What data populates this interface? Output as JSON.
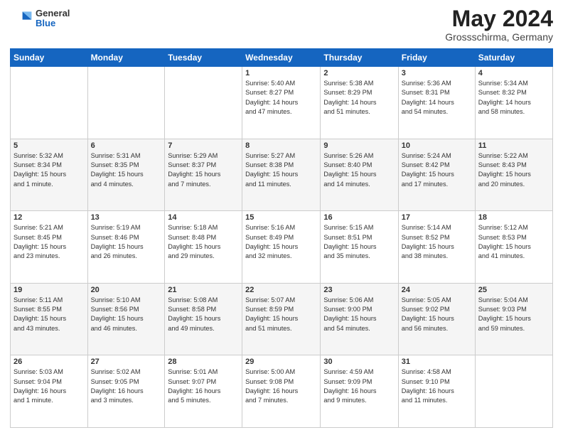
{
  "header": {
    "logo": {
      "general": "General",
      "blue": "Blue"
    },
    "title": "May 2024",
    "location": "Grossschirma, Germany"
  },
  "weekdays": [
    "Sunday",
    "Monday",
    "Tuesday",
    "Wednesday",
    "Thursday",
    "Friday",
    "Saturday"
  ],
  "weeks": [
    [
      {
        "day": "",
        "info": ""
      },
      {
        "day": "",
        "info": ""
      },
      {
        "day": "",
        "info": ""
      },
      {
        "day": "1",
        "info": "Sunrise: 5:40 AM\nSunset: 8:27 PM\nDaylight: 14 hours\nand 47 minutes."
      },
      {
        "day": "2",
        "info": "Sunrise: 5:38 AM\nSunset: 8:29 PM\nDaylight: 14 hours\nand 51 minutes."
      },
      {
        "day": "3",
        "info": "Sunrise: 5:36 AM\nSunset: 8:31 PM\nDaylight: 14 hours\nand 54 minutes."
      },
      {
        "day": "4",
        "info": "Sunrise: 5:34 AM\nSunset: 8:32 PM\nDaylight: 14 hours\nand 58 minutes."
      }
    ],
    [
      {
        "day": "5",
        "info": "Sunrise: 5:32 AM\nSunset: 8:34 PM\nDaylight: 15 hours\nand 1 minute."
      },
      {
        "day": "6",
        "info": "Sunrise: 5:31 AM\nSunset: 8:35 PM\nDaylight: 15 hours\nand 4 minutes."
      },
      {
        "day": "7",
        "info": "Sunrise: 5:29 AM\nSunset: 8:37 PM\nDaylight: 15 hours\nand 7 minutes."
      },
      {
        "day": "8",
        "info": "Sunrise: 5:27 AM\nSunset: 8:38 PM\nDaylight: 15 hours\nand 11 minutes."
      },
      {
        "day": "9",
        "info": "Sunrise: 5:26 AM\nSunset: 8:40 PM\nDaylight: 15 hours\nand 14 minutes."
      },
      {
        "day": "10",
        "info": "Sunrise: 5:24 AM\nSunset: 8:42 PM\nDaylight: 15 hours\nand 17 minutes."
      },
      {
        "day": "11",
        "info": "Sunrise: 5:22 AM\nSunset: 8:43 PM\nDaylight: 15 hours\nand 20 minutes."
      }
    ],
    [
      {
        "day": "12",
        "info": "Sunrise: 5:21 AM\nSunset: 8:45 PM\nDaylight: 15 hours\nand 23 minutes."
      },
      {
        "day": "13",
        "info": "Sunrise: 5:19 AM\nSunset: 8:46 PM\nDaylight: 15 hours\nand 26 minutes."
      },
      {
        "day": "14",
        "info": "Sunrise: 5:18 AM\nSunset: 8:48 PM\nDaylight: 15 hours\nand 29 minutes."
      },
      {
        "day": "15",
        "info": "Sunrise: 5:16 AM\nSunset: 8:49 PM\nDaylight: 15 hours\nand 32 minutes."
      },
      {
        "day": "16",
        "info": "Sunrise: 5:15 AM\nSunset: 8:51 PM\nDaylight: 15 hours\nand 35 minutes."
      },
      {
        "day": "17",
        "info": "Sunrise: 5:14 AM\nSunset: 8:52 PM\nDaylight: 15 hours\nand 38 minutes."
      },
      {
        "day": "18",
        "info": "Sunrise: 5:12 AM\nSunset: 8:53 PM\nDaylight: 15 hours\nand 41 minutes."
      }
    ],
    [
      {
        "day": "19",
        "info": "Sunrise: 5:11 AM\nSunset: 8:55 PM\nDaylight: 15 hours\nand 43 minutes."
      },
      {
        "day": "20",
        "info": "Sunrise: 5:10 AM\nSunset: 8:56 PM\nDaylight: 15 hours\nand 46 minutes."
      },
      {
        "day": "21",
        "info": "Sunrise: 5:08 AM\nSunset: 8:58 PM\nDaylight: 15 hours\nand 49 minutes."
      },
      {
        "day": "22",
        "info": "Sunrise: 5:07 AM\nSunset: 8:59 PM\nDaylight: 15 hours\nand 51 minutes."
      },
      {
        "day": "23",
        "info": "Sunrise: 5:06 AM\nSunset: 9:00 PM\nDaylight: 15 hours\nand 54 minutes."
      },
      {
        "day": "24",
        "info": "Sunrise: 5:05 AM\nSunset: 9:02 PM\nDaylight: 15 hours\nand 56 minutes."
      },
      {
        "day": "25",
        "info": "Sunrise: 5:04 AM\nSunset: 9:03 PM\nDaylight: 15 hours\nand 59 minutes."
      }
    ],
    [
      {
        "day": "26",
        "info": "Sunrise: 5:03 AM\nSunset: 9:04 PM\nDaylight: 16 hours\nand 1 minute."
      },
      {
        "day": "27",
        "info": "Sunrise: 5:02 AM\nSunset: 9:05 PM\nDaylight: 16 hours\nand 3 minutes."
      },
      {
        "day": "28",
        "info": "Sunrise: 5:01 AM\nSunset: 9:07 PM\nDaylight: 16 hours\nand 5 minutes."
      },
      {
        "day": "29",
        "info": "Sunrise: 5:00 AM\nSunset: 9:08 PM\nDaylight: 16 hours\nand 7 minutes."
      },
      {
        "day": "30",
        "info": "Sunrise: 4:59 AM\nSunset: 9:09 PM\nDaylight: 16 hours\nand 9 minutes."
      },
      {
        "day": "31",
        "info": "Sunrise: 4:58 AM\nSunset: 9:10 PM\nDaylight: 16 hours\nand 11 minutes."
      },
      {
        "day": "",
        "info": ""
      }
    ]
  ]
}
